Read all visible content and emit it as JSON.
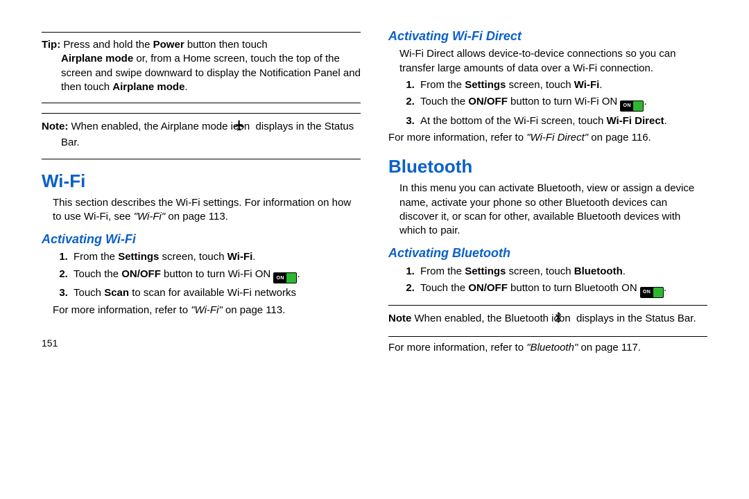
{
  "page_number": "151",
  "left": {
    "tip_label": "Tip:",
    "tip_l1a": " Press and hold the ",
    "tip_l1b": "Power",
    "tip_l1c": " button then touch",
    "tip_l2a": "Airplane mode",
    "tip_l2b": " or, from a Home screen, touch the top of the screen and swipe downward to display the Notification Panel and then touch ",
    "tip_l2c": "Airplane mode",
    "tip_l2d": ".",
    "note_label": "Note:",
    "note_a": " When enabled, the Airplane mode icon ",
    "note_b": " displays in the Status Bar.",
    "h_wifi": "Wi-Fi",
    "wifi_intro_a": "This section describes the Wi-Fi settings. For information on how to use Wi-Fi, see ",
    "wifi_intro_b": "\"Wi-Fi\"",
    "wifi_intro_c": " on page 113.",
    "h_act_wifi": "Activating Wi-Fi",
    "s1a": "From the ",
    "s1b": "Settings",
    "s1c": " screen, touch ",
    "s1d": "Wi-Fi",
    "s1e": ".",
    "s2a": "Touch the ",
    "s2b": "ON/OFF",
    "s2c": " button to turn Wi-Fi ON ",
    "s2d": ".",
    "s3a": "Touch ",
    "s3b": "Scan",
    "s3c": " to scan for available Wi-Fi networks",
    "more_a": "For more information, refer to ",
    "more_b": "\"Wi-Fi\"",
    "more_c": " on page 113.",
    "toggle_label": "ON"
  },
  "right": {
    "h_direct": "Activating Wi-Fi Direct",
    "direct_intro": "Wi-Fi Direct allows device-to-device connections so you can transfer large amounts of data over a Wi-Fi connection.",
    "d1a": "From the ",
    "d1b": "Settings",
    "d1c": " screen, touch ",
    "d1d": "Wi-Fi",
    "d1e": ".",
    "d2a": "Touch the ",
    "d2b": "ON/OFF",
    "d2c": " button to turn Wi-Fi ON ",
    "d2d": ".",
    "d3a": "At the bottom of the Wi-Fi screen, touch ",
    "d3b": "Wi-Fi Direct",
    "d3c": ".",
    "dmore_a": "For more information, refer to ",
    "dmore_b": "\"Wi-Fi Direct\"",
    "dmore_c": " on page 116.",
    "h_bt": "Bluetooth",
    "bt_intro": "In this menu you can activate Bluetooth, view or assign a device name, activate your phone so other Bluetooth devices can discover it, or scan for other, available Bluetooth devices with which to pair.",
    "h_act_bt": "Activating Bluetooth",
    "b1a": "From the ",
    "b1b": "Settings",
    "b1c": " screen, touch ",
    "b1d": "Bluetooth",
    "b1e": ".",
    "b2a": "Touch the ",
    "b2b": "ON/OFF",
    "b2c": " button to turn Bluetooth ON ",
    "b2d": ".",
    "btnote_label": "Note",
    "btnote_a": " When enabled, the Bluetooth icon ",
    "btnote_b": " displays in the Status Bar.",
    "btmore_a": "For more information, refer to ",
    "btmore_b": "\"Bluetooth\"",
    "btmore_c": " on page 117.",
    "toggle_label": "ON"
  }
}
